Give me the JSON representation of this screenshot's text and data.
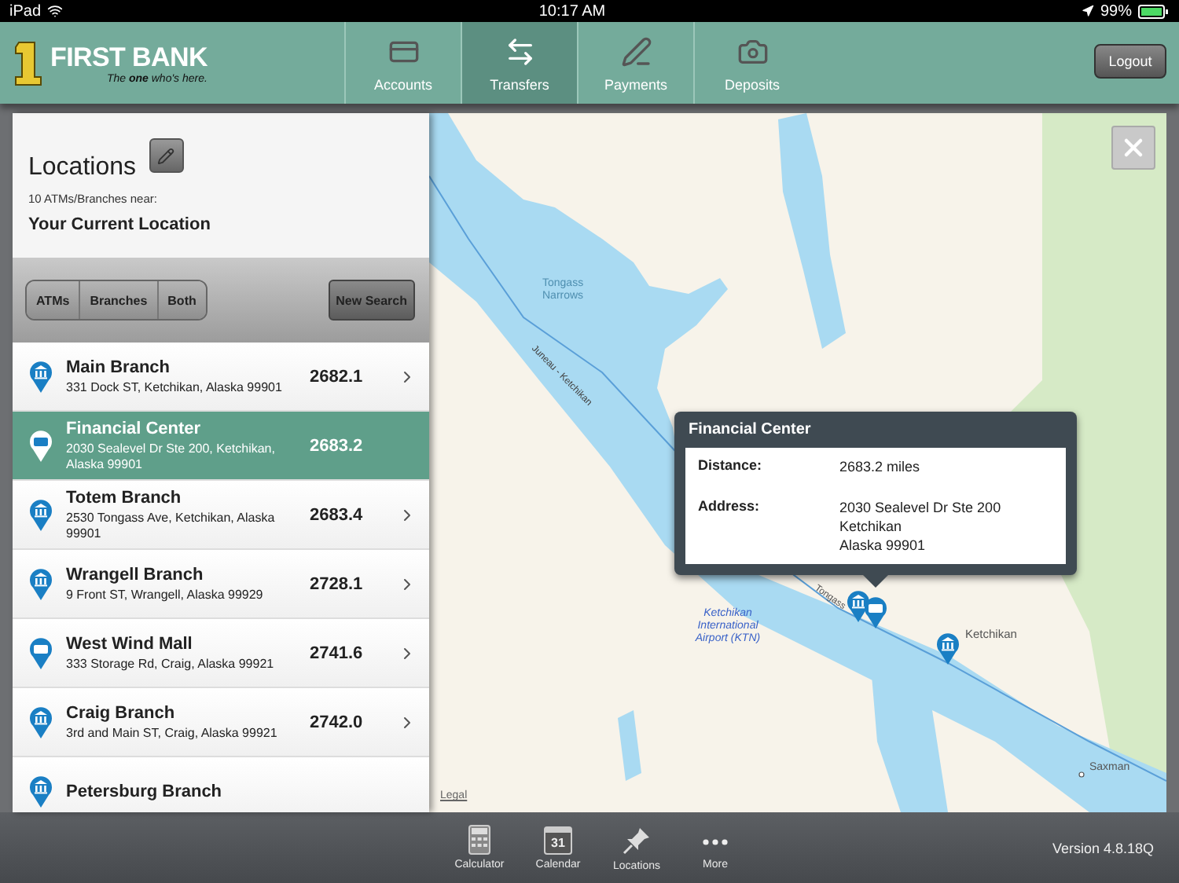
{
  "status_bar": {
    "device": "iPad",
    "time": "10:17 AM",
    "battery": "99%"
  },
  "header": {
    "brand": "FIRST BANK",
    "tagline": "The **one** who's here.",
    "logout": "Logout"
  },
  "tabs": [
    {
      "label": "Accounts",
      "selected": false
    },
    {
      "label": "Transfers",
      "selected": true
    },
    {
      "label": "Payments",
      "selected": false
    },
    {
      "label": "Deposits",
      "selected": false
    }
  ],
  "panel": {
    "title": "Locations",
    "count": "10 ATMs/Branches near:",
    "place": "Your Current Location",
    "filters": [
      {
        "label": "ATMs",
        "selected": false
      },
      {
        "label": "Branches",
        "selected": false
      },
      {
        "label": "Both",
        "selected": false
      }
    ],
    "new_search": "New Search",
    "rows": [
      {
        "kind": "bank",
        "name": "Main Branch",
        "address": "331 Dock ST, Ketchikan, Alaska  99901",
        "distance": "2682.1",
        "selected": false
      },
      {
        "kind": "atm",
        "name": "Financial Center",
        "address": "2030 Sealevel Dr Ste 200, Ketchikan, Alaska  99901",
        "distance": "2683.2",
        "selected": true
      },
      {
        "kind": "bank",
        "name": "Totem Branch",
        "address": "2530 Tongass Ave, Ketchikan, Alaska  99901",
        "distance": "2683.4",
        "selected": false
      },
      {
        "kind": "bank",
        "name": "Wrangell Branch",
        "address": "9 Front ST, Wrangell, Alaska  99929",
        "distance": "2728.1",
        "selected": false
      },
      {
        "kind": "atm",
        "name": "West Wind Mall",
        "address": "333 Storage Rd, Craig, Alaska  99921",
        "distance": "2741.6",
        "selected": false
      },
      {
        "kind": "bank",
        "name": "Craig Branch",
        "address": "3rd and Main ST, Craig, Alaska  99921",
        "distance": "2742.0",
        "selected": false
      },
      {
        "kind": "bank",
        "name": "Petersburg Branch",
        "selected": false
      }
    ]
  },
  "map": {
    "labels": [
      "Tongass Narrows",
      "Juneau - Ketchikan",
      "Ketchikan International Airport (KTN)",
      "Tongass",
      "Ketchikan",
      "Saxman"
    ],
    "legal": "Legal",
    "popup": {
      "title": "Financial Center",
      "fields": [
        {
          "label": "Distance:",
          "value": "2683.2 miles"
        },
        {
          "label": "Address:",
          "value": "2030 Sealevel Dr Ste 200\nKetchikan\nAlaska  99901"
        }
      ]
    }
  },
  "toolbar": {
    "items": [
      {
        "label": "Calculator"
      },
      {
        "label": "Calendar",
        "badge": "31"
      },
      {
        "label": "Locations"
      },
      {
        "label": "More"
      }
    ],
    "version": "Version 4.8.18Q"
  }
}
